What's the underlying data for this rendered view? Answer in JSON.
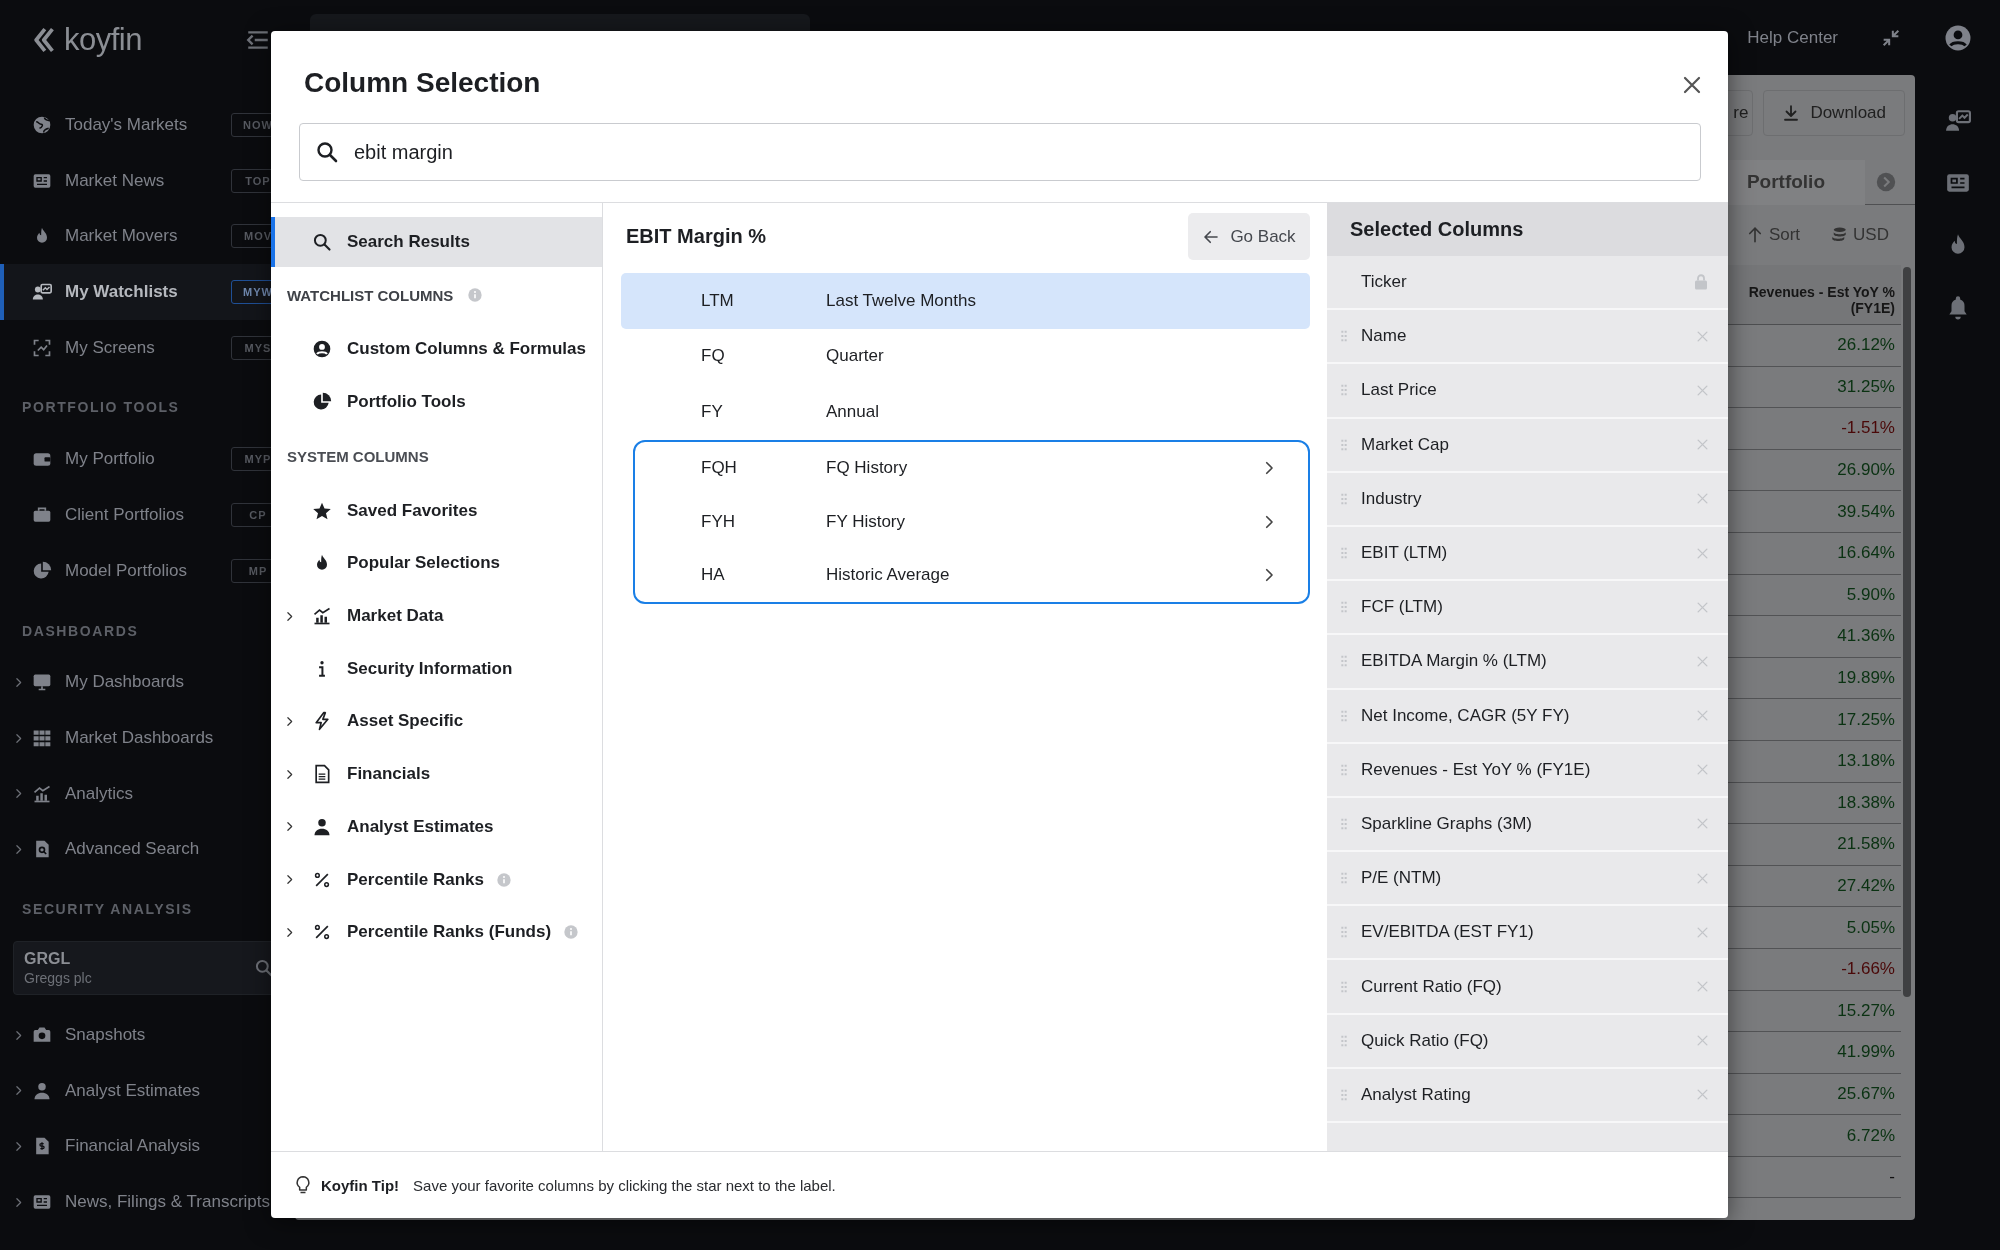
{
  "sidebar": {
    "logo": "koyfin",
    "sections": [
      {
        "items": [
          {
            "label": "Today's Markets",
            "badge": "NOW",
            "selected": false,
            "expandable": false
          },
          {
            "label": "Market News",
            "badge": "TOP",
            "selected": false,
            "expandable": false
          },
          {
            "label": "Market Movers",
            "badge": "MOV",
            "selected": false,
            "expandable": false
          },
          {
            "label": "My Watchlists",
            "badge": "MYW",
            "selected": true,
            "expandable": false
          },
          {
            "label": "My Screens",
            "badge": "MYS",
            "selected": false,
            "expandable": false
          }
        ]
      },
      {
        "heading": "PORTFOLIO TOOLS",
        "items": [
          {
            "label": "My Portfolio",
            "badge": "MYP",
            "selected": false,
            "expandable": false
          },
          {
            "label": "Client Portfolios",
            "badge": "CP",
            "selected": false,
            "expandable": false
          },
          {
            "label": "Model Portfolios",
            "badge": "MP",
            "selected": false,
            "expandable": false
          }
        ]
      },
      {
        "heading": "DASHBOARDS",
        "items": [
          {
            "label": "My Dashboards",
            "selected": false,
            "expandable": true
          },
          {
            "label": "Market Dashboards",
            "selected": false,
            "expandable": true
          },
          {
            "label": "Analytics",
            "selected": false,
            "expandable": true
          },
          {
            "label": "Advanced Search",
            "selected": false,
            "expandable": true
          }
        ]
      },
      {
        "heading": "SECURITY ANALYSIS",
        "ticker_card": {
          "ticker": "GRGL",
          "name": "Greggs plc"
        },
        "items": [
          {
            "label": "Snapshots",
            "selected": false,
            "expandable": true
          },
          {
            "label": "Analyst Estimates",
            "selected": false,
            "expandable": true
          },
          {
            "label": "Financial Analysis",
            "selected": false,
            "expandable": true
          },
          {
            "label": "News, Filings & Transcripts",
            "selected": false,
            "expandable": true
          }
        ]
      }
    ]
  },
  "top_bar": {
    "help": "Help Center"
  },
  "watchlist": {
    "buttons": [
      "re",
      "Download"
    ],
    "tab": "Portfolio",
    "sort": "Sort",
    "currency": "USD",
    "column": "Revenues - Est YoY % (FY1E)",
    "rows": [
      {
        "value": "26.12%",
        "color": "#0a3212"
      },
      {
        "value": "31.25%",
        "color": "#0a3212"
      },
      {
        "value": "-1.51%",
        "color": "#4a0808"
      },
      {
        "value": "26.90%",
        "color": "#0a3212"
      },
      {
        "value": "39.54%",
        "color": "#0a3212"
      },
      {
        "value": "16.64%",
        "color": "#0a3212"
      },
      {
        "value": "5.90%",
        "color": "#0a3212"
      },
      {
        "value": "41.36%",
        "color": "#0a3212"
      },
      {
        "value": "19.89%",
        "color": "#0a3212"
      },
      {
        "value": "17.25%",
        "color": "#0a3212"
      },
      {
        "value": "13.18%",
        "color": "#0a3212"
      },
      {
        "value": "18.38%",
        "color": "#0a3212"
      },
      {
        "value": "21.58%",
        "color": "#0a3212"
      },
      {
        "value": "27.42%",
        "color": "#0a3212"
      },
      {
        "value": "5.05%",
        "color": "#0a3212"
      },
      {
        "value": "-1.66%",
        "color": "#4a0808"
      },
      {
        "value": "15.27%",
        "color": "#0a3212"
      },
      {
        "value": "41.99%",
        "color": "#0a3212"
      },
      {
        "value": "25.67%",
        "color": "#0a3212"
      },
      {
        "value": "6.72%",
        "color": "#0a3212"
      },
      {
        "value": "-",
        "color": "#111111"
      }
    ]
  },
  "modal": {
    "title": "Column Selection",
    "search": {
      "value": "ebit margin"
    },
    "search_results": {
      "label": "Search Results",
      "selected": true
    },
    "category_groups": [
      {
        "heading": "WATCHLIST COLUMNS",
        "info": true,
        "items": [
          {
            "label": "Custom Columns & Formulas",
            "selected": false,
            "expandable": false,
            "info": false
          },
          {
            "label": "Portfolio Tools",
            "selected": false,
            "expandable": false,
            "info": false
          }
        ]
      },
      {
        "heading": "SYSTEM COLUMNS",
        "info": false,
        "items": [
          {
            "label": "Saved Favorites",
            "selected": false,
            "expandable": false,
            "info": false
          },
          {
            "label": "Popular Selections",
            "selected": false,
            "expandable": false,
            "info": false
          },
          {
            "label": "Market Data",
            "selected": false,
            "expandable": true,
            "info": false
          },
          {
            "label": "Security Information",
            "selected": false,
            "expandable": false,
            "info": false
          },
          {
            "label": "Asset Specific",
            "selected": false,
            "expandable": true,
            "info": false
          },
          {
            "label": "Financials",
            "selected": false,
            "expandable": true,
            "info": false
          },
          {
            "label": "Analyst Estimates",
            "selected": false,
            "expandable": true,
            "info": false
          },
          {
            "label": "Percentile Ranks",
            "selected": false,
            "expandable": true,
            "info": true
          },
          {
            "label": "Percentile Ranks (Funds)",
            "selected": false,
            "expandable": true,
            "info": true
          }
        ]
      }
    ],
    "detail": {
      "title": "EBIT Margin %",
      "back": "Go Back",
      "periods": [
        {
          "code": "LTM",
          "label": "Last Twelve Months",
          "selected": true
        },
        {
          "code": "FQ",
          "label": "Quarter",
          "selected": false
        },
        {
          "code": "FY",
          "label": "Annual",
          "selected": false
        }
      ],
      "history_periods": [
        {
          "code": "FQH",
          "label": "FQ History",
          "selected": false
        },
        {
          "code": "FYH",
          "label": "FY History",
          "selected": false
        },
        {
          "code": "HA",
          "label": "Historic Average",
          "selected": false
        }
      ]
    },
    "selected_columns": {
      "title": "Selected Columns",
      "items": [
        {
          "label": "Ticker",
          "locked": true
        },
        {
          "label": "Name",
          "locked": false
        },
        {
          "label": "Last Price",
          "locked": false
        },
        {
          "label": "Market Cap",
          "locked": false
        },
        {
          "label": "Industry",
          "locked": false
        },
        {
          "label": "EBIT (LTM)",
          "locked": false
        },
        {
          "label": "FCF (LTM)",
          "locked": false
        },
        {
          "label": "EBITDA Margin % (LTM)",
          "locked": false
        },
        {
          "label": "Net Income, CAGR (5Y FY)",
          "locked": false
        },
        {
          "label": "Revenues - Est YoY % (FY1E)",
          "locked": false
        },
        {
          "label": "Sparkline Graphs (3M)",
          "locked": false
        },
        {
          "label": "P/E (NTM)",
          "locked": false
        },
        {
          "label": "EV/EBITDA (EST FY1)",
          "locked": false
        },
        {
          "label": "Current Ratio (FQ)",
          "locked": false
        },
        {
          "label": "Quick Ratio (FQ)",
          "locked": false
        },
        {
          "label": "Analyst Rating",
          "locked": false
        }
      ]
    },
    "tip": {
      "title": "Koyfin Tip!",
      "text": "Save your favorite columns by clicking the star next to the label."
    }
  }
}
